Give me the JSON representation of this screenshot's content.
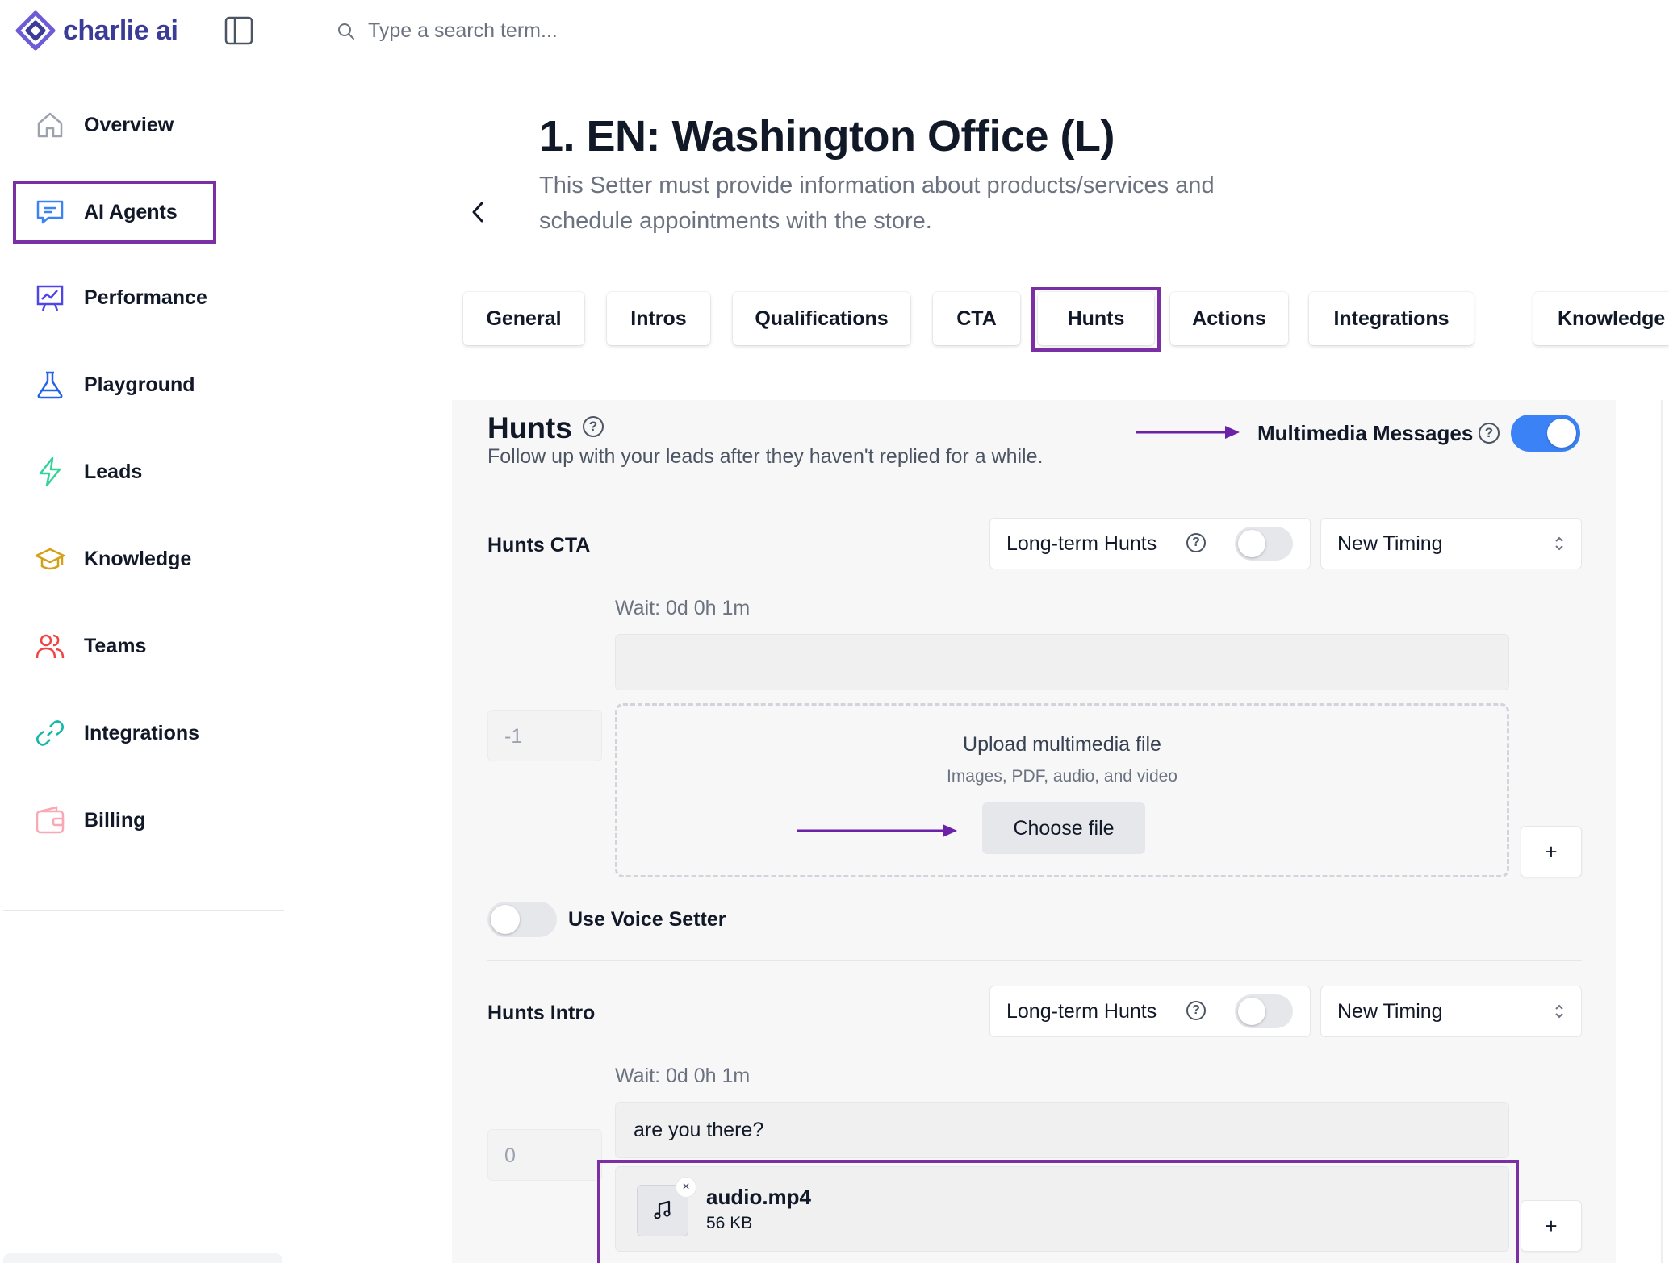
{
  "app": {
    "name": "charlie ai",
    "brand_color": "#3b3b98",
    "accent_color": "#7b2fa5"
  },
  "search": {
    "placeholder": "Type a search term..."
  },
  "sidebar": {
    "items": [
      {
        "label": "Overview",
        "icon": "home-icon"
      },
      {
        "label": "AI Agents",
        "icon": "chat-icon",
        "active": true
      },
      {
        "label": "Performance",
        "icon": "presentation-chart-icon"
      },
      {
        "label": "Playground",
        "icon": "flask-icon"
      },
      {
        "label": "Leads",
        "icon": "lightning-icon"
      },
      {
        "label": "Knowledge",
        "icon": "graduation-cap-icon"
      },
      {
        "label": "Teams",
        "icon": "users-icon"
      },
      {
        "label": "Integrations",
        "icon": "link-icon"
      },
      {
        "label": "Billing",
        "icon": "wallet-icon"
      }
    ]
  },
  "header": {
    "title": "1. EN: Washington Office (L)",
    "description": "This Setter must provide information about products/services and schedule appointments with the store."
  },
  "tabs": [
    {
      "label": "General"
    },
    {
      "label": "Intros"
    },
    {
      "label": "Qualifications"
    },
    {
      "label": "CTA"
    },
    {
      "label": "Hunts",
      "active": true
    },
    {
      "label": "Actions"
    },
    {
      "label": "Integrations"
    },
    {
      "label": "Knowledge"
    }
  ],
  "hunts": {
    "title": "Hunts",
    "subtitle": "Follow up with your leads after they haven't replied for a while.",
    "multimedia_label": "Multimedia Messages",
    "multimedia_enabled": true,
    "cta": {
      "label": "Hunts CTA",
      "long_term_label": "Long-term Hunts",
      "long_term_enabled": false,
      "timing": "New Timing",
      "wait": "Wait: 0d 0h 1m",
      "message": "",
      "index_value": "-1",
      "upload_title": "Upload multimedia file",
      "upload_sub": "Images, PDF, audio, and video",
      "choose_file": "Choose file",
      "add": "+"
    },
    "voice": {
      "label": "Use Voice Setter",
      "enabled": false
    },
    "intro": {
      "label": "Hunts Intro",
      "long_term_label": "Long-term Hunts",
      "long_term_enabled": false,
      "timing": "New Timing",
      "wait": "Wait: 0d 0h 1m",
      "message": "are you there?",
      "index_value": "0",
      "attachment": {
        "name": "audio.mp4",
        "size": "56 KB",
        "remove": "×"
      },
      "add": "+"
    }
  }
}
